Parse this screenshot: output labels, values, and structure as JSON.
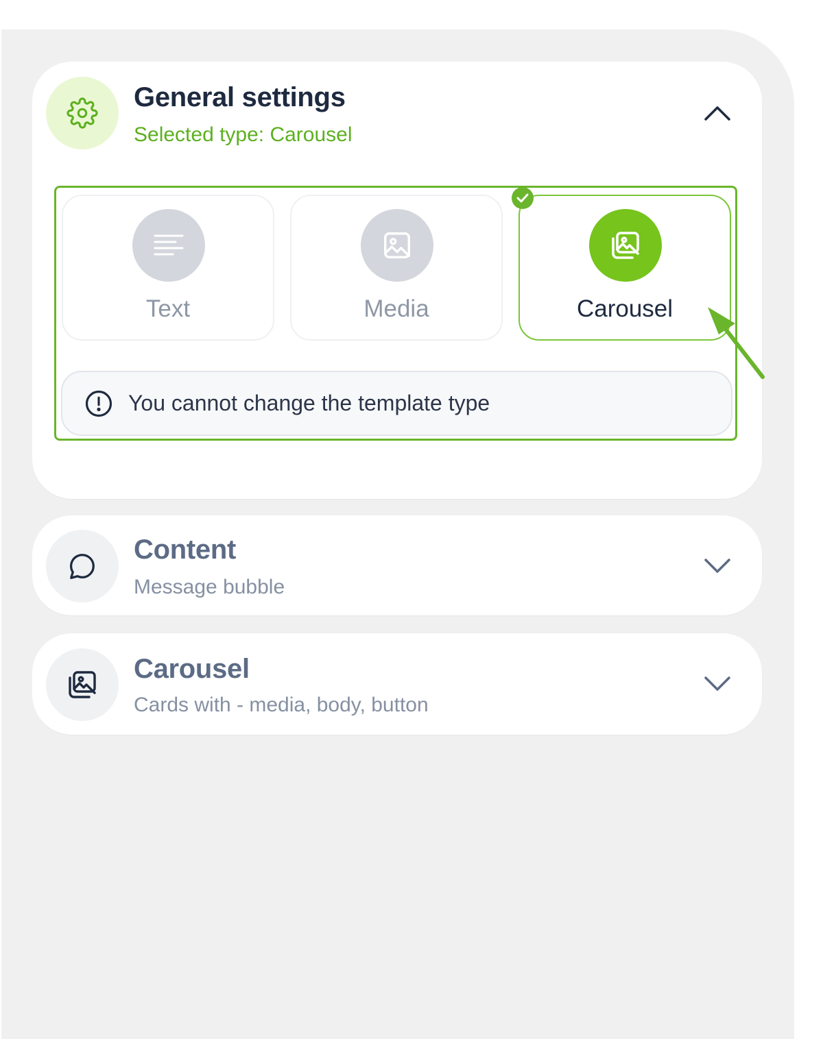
{
  "general_settings": {
    "title": "General settings",
    "subtitle": "Selected type: Carousel",
    "icon": "gear-icon",
    "expanded": true,
    "types": [
      {
        "label": "Text",
        "icon": "text-lines-icon",
        "selected": false
      },
      {
        "label": "Media",
        "icon": "image-icon",
        "selected": false
      },
      {
        "label": "Carousel",
        "icon": "gallery-icon",
        "selected": true
      }
    ],
    "notice": "You cannot change the template type"
  },
  "content_section": {
    "title": "Content",
    "subtitle": "Message bubble",
    "icon": "chat-bubble-icon",
    "expanded": false
  },
  "carousel_section": {
    "title": "Carousel",
    "subtitle": "Cards with - media, body, button",
    "icon": "gallery-icon",
    "expanded": false
  },
  "colors": {
    "accent_green": "#76c41c",
    "highlight_green": "#6ab52c",
    "title_dark": "#1e2a3f",
    "muted_gray": "#8590a2",
    "panel_bg": "#f0f0f0"
  }
}
